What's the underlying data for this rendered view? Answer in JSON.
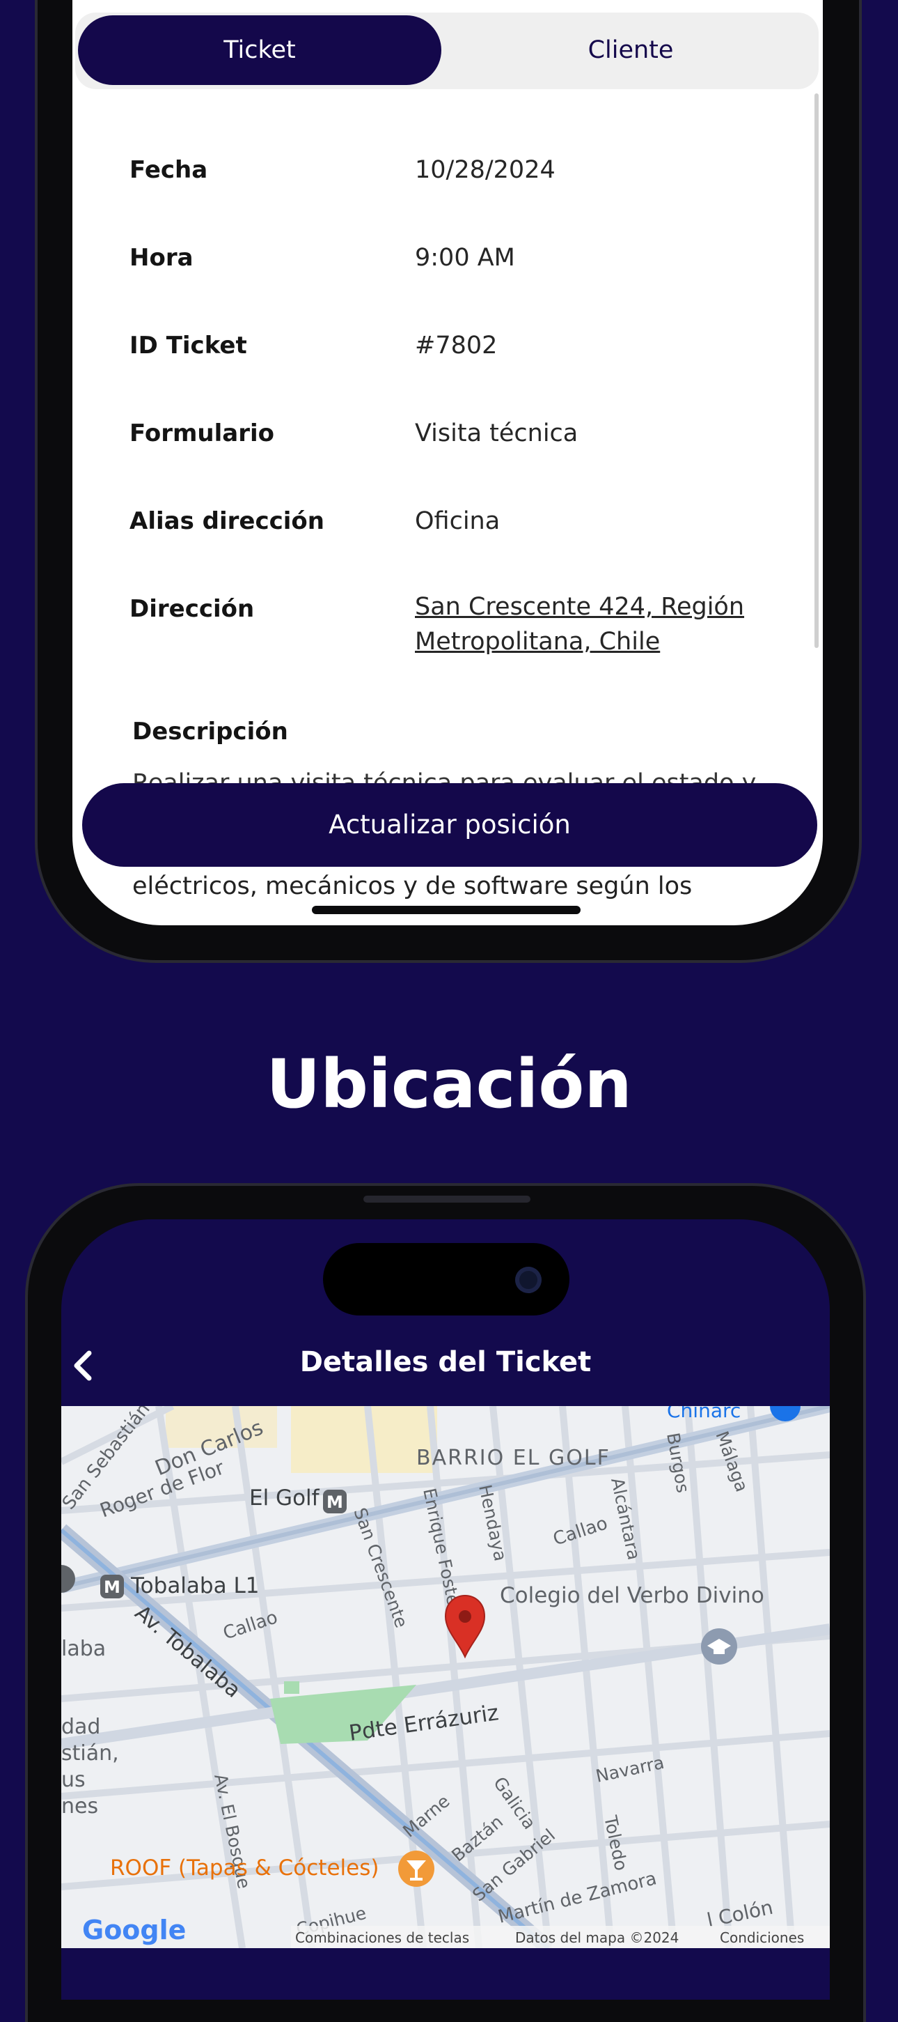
{
  "tabs": {
    "ticket": "Ticket",
    "cliente": "Cliente"
  },
  "details": [
    {
      "label": "Fecha",
      "value": "10/28/2024"
    },
    {
      "label": "Hora",
      "value": "9:00 AM"
    },
    {
      "label": "ID Ticket",
      "value": "#7802"
    },
    {
      "label": "Formulario",
      "value": "Visita técnica"
    },
    {
      "label": "Alias dirección",
      "value": "Oficina"
    },
    {
      "label": "Dirección",
      "value_line1": "San Crescente 424, Región",
      "value_line2": "Metropolitana, Chile"
    }
  ],
  "description": {
    "label": "Descripción",
    "partial_top": "Realizar una visita técnica para evaluar el estado y",
    "partial_bottom": "eléctricos, mecánicos y de software según los"
  },
  "update_button": "Actualizar posición",
  "section_heading": "Ubicación",
  "nav": {
    "back_icon": "chevron-left-icon",
    "title": "Detalles del Ticket"
  },
  "map": {
    "labels": {
      "barrio": "BARRIO EL GOLF",
      "don_carlos": "Don Carlos",
      "san_sebastian": "San Sebastián",
      "roger": "Roger de Flor",
      "el_golf": "El Golf",
      "metro_m": "M",
      "tobalaba_l1": "Tobalaba L1",
      "av_tobalaba": "Av. Tobalaba",
      "callao1": "Callao",
      "callao2": "Callao",
      "san_crescente": "San Crescente",
      "enrique_foster": "Enrique Foster",
      "hendaya": "Hendaya",
      "alcantara": "Alcántara",
      "burgos": "Burgos",
      "malaga": "Málaga",
      "colegio": "Colegio del Verbo Divino",
      "pdte": "Pdte Errázuriz",
      "av_el_bosque": "Av. El Bosque",
      "marne": "Marne",
      "baztan": "Baztán",
      "galicia": "Galicia",
      "navarra": "Navarra",
      "toledo": "Toledo",
      "san_gabriel": "San Gabriel",
      "martin": "Martín de Zamora",
      "roof": "ROOF (Tapas & Cócteles)",
      "copihue": "Copihue",
      "colon": "l Colón",
      "chinarc": "Chinarc",
      "laba": "laba",
      "dad": "dad",
      "stian": "stián,",
      "us": "us",
      "nes": "nes"
    },
    "footer": {
      "google": "Google",
      "shortcuts": "Combinaciones de teclas",
      "data": "Datos del mapa ©2024",
      "terms": "Condiciones"
    },
    "accent": "#14084b",
    "pin_color": "#d93025"
  }
}
